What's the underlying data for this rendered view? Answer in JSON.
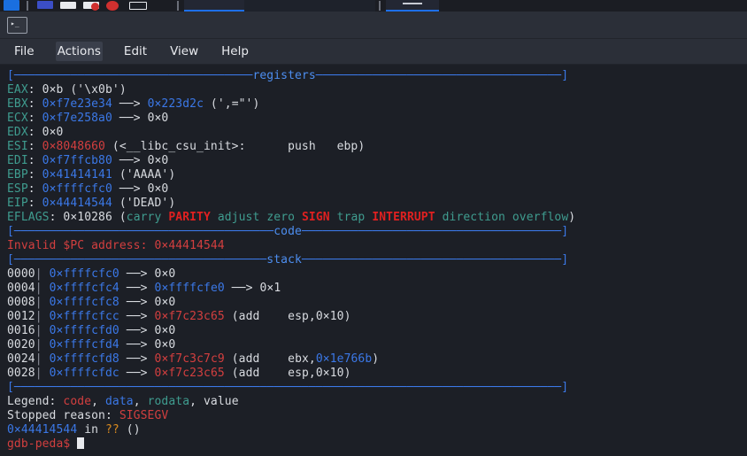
{
  "taskbar": {
    "icons": [
      {
        "name": "browser-icon",
        "color": "#1a6fe0"
      },
      {
        "name": "app-icon-blue",
        "color": "#3b4ec6"
      },
      {
        "name": "app-icon-white",
        "color": "#e8eaee"
      },
      {
        "name": "app-icon-red-dot",
        "color": "#e8eaee"
      },
      {
        "name": "record-icon-red",
        "color": "#d0302f"
      },
      {
        "name": "app-icon-outline",
        "color": "#1c1f26"
      }
    ],
    "windows": [
      {
        "name": "taskbar-window-1",
        "active": true
      },
      {
        "name": "taskbar-window-2",
        "active": false
      },
      {
        "name": "taskbar-window-3",
        "active": true
      }
    ]
  },
  "window": {
    "tab_icon": "terminal-icon",
    "tab_prompt_glyph": "▸_",
    "menu": [
      "File",
      "Actions",
      "Edit",
      "View",
      "Help"
    ],
    "hovered_menu": "Actions"
  },
  "terminal": {
    "sections": {
      "registers_title": "registers",
      "code_title": "code",
      "stack_title": "stack"
    },
    "registers": [
      {
        "name": "EAX",
        "value": "0x b",
        "text": "0xb ('\\x0b')"
      },
      {
        "name": "EBX",
        "value": "0xf7e23e34",
        "text": "0xf7e23e34 --> 0x223d2c (',=\"')"
      },
      {
        "name": "ECX",
        "value": "0xf7e258a0",
        "text": "0xf7e258a0 --> 0x0"
      },
      {
        "name": "EDX",
        "value": "0x0",
        "text": "0x0"
      },
      {
        "name": "ESI",
        "value": "0x8048660",
        "text": "0x8048660 (<__libc_csu_init>:\tpush   ebp)"
      },
      {
        "name": "EDI",
        "value": "0xf7ffcb80",
        "text": "0xf7ffcb80 --> 0x0"
      },
      {
        "name": "EBP",
        "value": "0x41414141",
        "text": "0x41414141 ('AAAA')"
      },
      {
        "name": "ESP",
        "value": "0xffffcfc0",
        "text": "0xffffcfc0 --> 0x0"
      },
      {
        "name": "EIP",
        "value": "0x44414544",
        "text": "0x44414544 ('DEAD')"
      }
    ],
    "eflags": {
      "label": "EFLAGS",
      "value": "0x10286",
      "flags": [
        {
          "name": "carry",
          "set": false
        },
        {
          "name": "PARITY",
          "set": true
        },
        {
          "name": "adjust",
          "set": false
        },
        {
          "name": "zero",
          "set": false
        },
        {
          "name": "SIGN",
          "set": true
        },
        {
          "name": "trap",
          "set": false
        },
        {
          "name": "INTERRUPT",
          "set": true
        },
        {
          "name": "direction",
          "set": false
        },
        {
          "name": "overflow",
          "set": false
        }
      ]
    },
    "code_error": "Invalid $PC address: 0x44414544",
    "stack": [
      {
        "offset": "0000",
        "addr": "0xffffcfc0",
        "chain": "--> 0x0"
      },
      {
        "offset": "0004",
        "addr": "0xffffcfc4",
        "chain": "--> 0xffffcfe0 --> 0x1"
      },
      {
        "offset": "0008",
        "addr": "0xffffcfc8",
        "chain": "--> 0x0"
      },
      {
        "offset": "0012",
        "addr": "0xffffcfcc",
        "chain": "--> 0xf7c23c65 (add    esp,0x10)"
      },
      {
        "offset": "0016",
        "addr": "0xffffcfd0",
        "chain": "--> 0x0"
      },
      {
        "offset": "0020",
        "addr": "0xffffcfd4",
        "chain": "--> 0x0"
      },
      {
        "offset": "0024",
        "addr": "0xffffcfd8",
        "chain": "--> 0xf7c3c7c9 (add    ebx,0x1e766b)"
      },
      {
        "offset": "0028",
        "addr": "0xffffcfdc",
        "chain": "--> 0xf7c23c65 (add    esp,0x10)"
      }
    ],
    "legend": {
      "label": "Legend:",
      "items": [
        "code",
        "data",
        "rodata",
        "value"
      ]
    },
    "stopped_reason": {
      "label": "Stopped reason:",
      "signal": "SIGSEGV"
    },
    "stop_location": {
      "addr": "0x44414544",
      "in": "in",
      "fn": "??",
      "args": "()"
    },
    "prompt": "gdb-peda$"
  },
  "colors": {
    "code_red": "#d33f3f",
    "data_blue": "#3b78e7",
    "rodata_teal": "#3f9c8f",
    "value_white": "#d8dbe0",
    "separator": "#3b78e7",
    "accent": "#1d6fe8"
  }
}
